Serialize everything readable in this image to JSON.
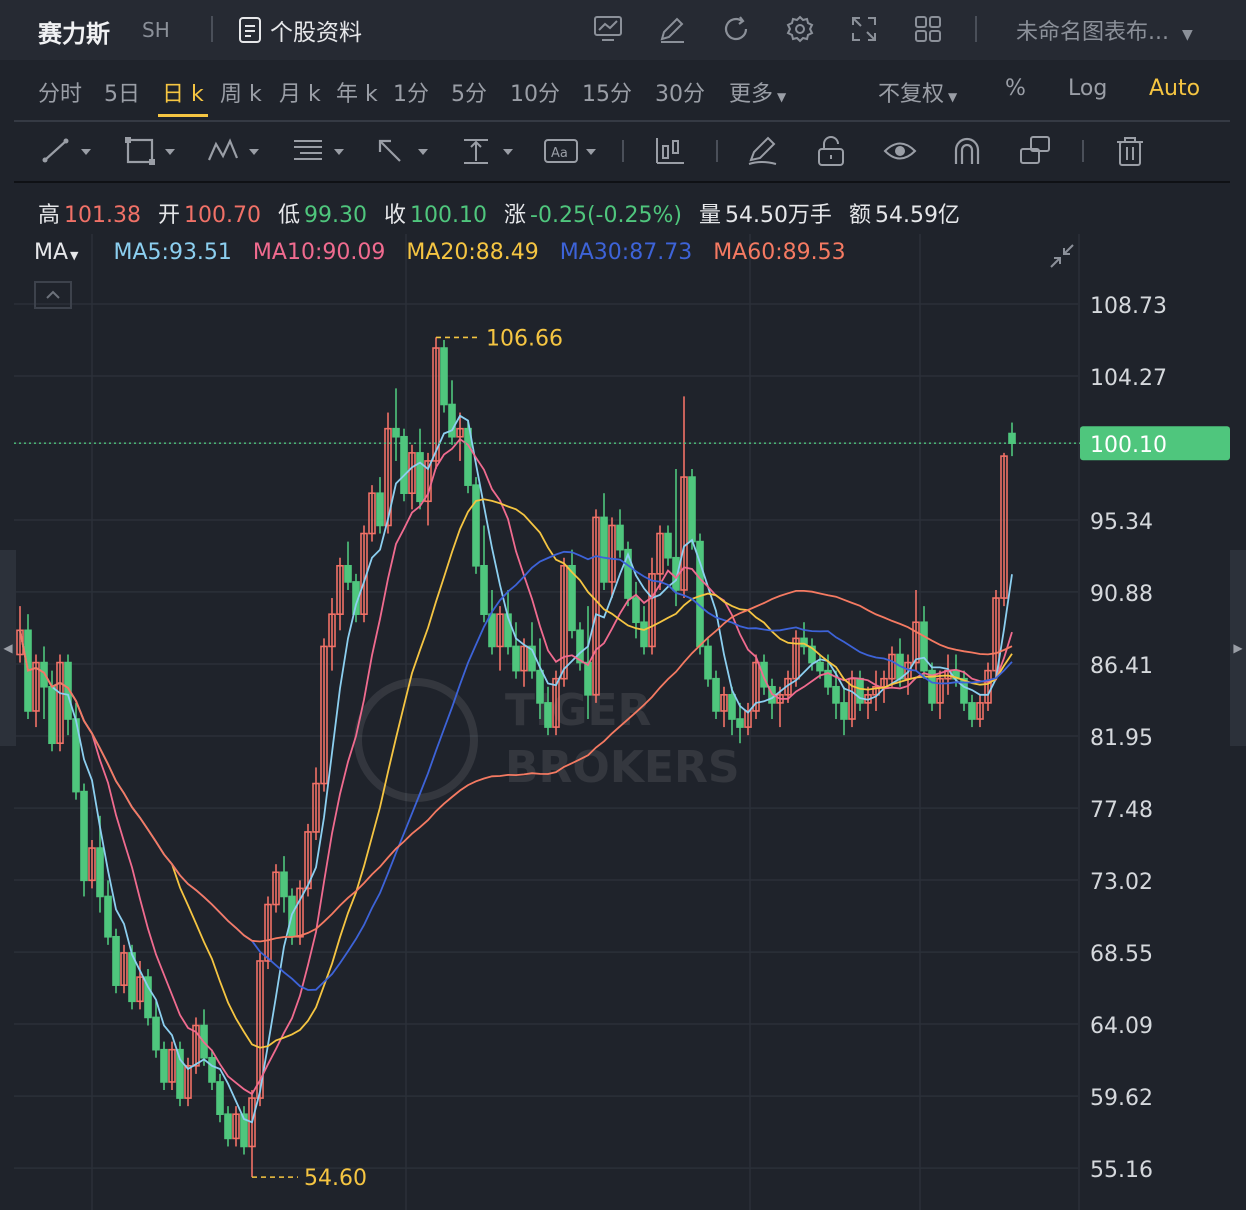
{
  "header": {
    "stock_name": "赛力斯",
    "market": "SH",
    "profile_label": "个股资料",
    "chart_selector": "未命名图表布...",
    "icons": [
      "chart-line-icon",
      "edit-icon",
      "refresh-icon",
      "gear-icon",
      "fullscreen-icon",
      "grid-icon"
    ]
  },
  "periods": {
    "items": [
      "分时",
      "5日",
      "日 k",
      "周 k",
      "月 k",
      "年 k",
      "1分",
      "5分",
      "10分",
      "15分",
      "30分",
      "更多"
    ],
    "active": "日 k",
    "adjust_label": "不复权",
    "percent_label": "%",
    "log_label": "Log",
    "auto_label": "Auto"
  },
  "toolbar": {
    "icons": [
      "trend-line-icon",
      "rectangle-icon",
      "pattern-icon",
      "fib-icon",
      "arrow-icon",
      "price-range-icon",
      "text-icon",
      "indicator-icon",
      "brush-icon",
      "lock-icon",
      "eye-icon",
      "magnet-icon",
      "layers-icon",
      "trash-icon"
    ]
  },
  "quote": {
    "high_label": "高",
    "high": "101.38",
    "open_label": "开",
    "open": "100.70",
    "low_label": "低",
    "low": "99.30",
    "close_label": "收",
    "close": "100.10",
    "change_label": "涨",
    "change": "-0.25(-0.25%)",
    "volume_label": "量",
    "volume": "54.50万手",
    "amount_label": "额",
    "amount": "54.59亿"
  },
  "ma": {
    "label": "MA",
    "ma5": "MA5:93.51",
    "ma10": "MA10:90.09",
    "ma20": "MA20:88.49",
    "ma30": "MA30:87.73",
    "ma60": "MA60:89.53"
  },
  "colors": {
    "up": "#f07167",
    "down": "#4fc67d",
    "ma5": "#8ccff0",
    "ma10": "#f06b8f",
    "ma20": "#f5c542",
    "ma30": "#3d63d8",
    "ma60": "#f57a62"
  },
  "watermark": "TIGER BROKERS",
  "chart_data": {
    "type": "candlestick",
    "y_ticks": [
      "108.73",
      "104.27",
      "100.10",
      "95.34",
      "90.88",
      "86.41",
      "81.95",
      "77.48",
      "73.02",
      "68.55",
      "64.09",
      "59.62",
      "55.16"
    ],
    "last_price": "100.10",
    "high_marker": "106.66",
    "low_marker": "54.60",
    "ylim": [
      53.5,
      110.5
    ],
    "candles": [
      [
        87,
        90,
        86.5,
        88.5
      ],
      [
        88.5,
        89.5,
        83,
        83.5
      ],
      [
        83.5,
        87,
        82.5,
        86.5
      ],
      [
        86.5,
        87.5,
        83,
        85
      ],
      [
        85,
        86,
        81,
        81.5
      ],
      [
        81.5,
        87,
        81,
        86.5
      ],
      [
        86.5,
        87,
        82,
        83
      ],
      [
        83,
        84,
        78,
        78.5
      ],
      [
        78.5,
        79,
        72,
        73
      ],
      [
        73,
        75.5,
        72.5,
        75
      ],
      [
        75,
        77,
        71,
        72
      ],
      [
        72,
        73,
        69,
        69.5
      ],
      [
        69.5,
        70,
        66,
        66.5
      ],
      [
        66.5,
        69,
        66,
        68.5
      ],
      [
        68.5,
        69,
        65,
        65.5
      ],
      [
        65.5,
        68,
        65,
        67
      ],
      [
        67,
        67.5,
        64,
        64.5
      ],
      [
        64.5,
        65.5,
        62,
        62.5
      ],
      [
        62.5,
        63,
        60,
        60.5
      ],
      [
        60.5,
        63,
        60,
        62.5
      ],
      [
        62.5,
        63,
        59,
        59.5
      ],
      [
        59.5,
        62,
        59,
        61.5
      ],
      [
        61.5,
        64.5,
        61,
        64
      ],
      [
        64,
        65,
        61.5,
        62
      ],
      [
        62,
        62.5,
        60,
        60.5
      ],
      [
        60.5,
        61,
        58,
        58.5
      ],
      [
        58.5,
        59,
        56.5,
        57
      ],
      [
        57,
        59,
        56.5,
        58.5
      ],
      [
        58.5,
        59,
        56,
        56.5
      ],
      [
        56.5,
        60,
        54.6,
        59.5
      ],
      [
        59.5,
        68.5,
        59,
        68
      ],
      [
        68,
        72,
        67.5,
        71.5
      ],
      [
        71.5,
        74,
        71,
        73.5
      ],
      [
        73.5,
        74.5,
        71,
        72
      ],
      [
        72,
        72.5,
        69,
        69.5
      ],
      [
        69.5,
        73,
        69,
        72.5
      ],
      [
        72.5,
        76.5,
        72,
        76
      ],
      [
        76,
        80,
        75.5,
        79
      ],
      [
        79,
        88,
        78.5,
        87.5
      ],
      [
        87.5,
        90.5,
        86,
        89.5
      ],
      [
        89.5,
        93,
        88.5,
        92.5
      ],
      [
        92.5,
        94,
        91,
        91.5
      ],
      [
        91.5,
        92,
        89,
        89.5
      ],
      [
        89.5,
        95,
        89,
        94.5
      ],
      [
        94.5,
        97.5,
        94,
        97
      ],
      [
        97,
        98,
        94.5,
        95
      ],
      [
        95,
        102,
        94.5,
        101
      ],
      [
        101,
        103.5,
        99,
        100.5
      ],
      [
        100.5,
        101,
        96.5,
        97
      ],
      [
        97,
        100,
        96,
        99.5
      ],
      [
        99.5,
        101,
        96,
        96.5
      ],
      [
        96.5,
        99.5,
        95,
        99
      ],
      [
        99,
        106.66,
        98.5,
        106
      ],
      [
        106,
        106.5,
        102,
        102.5
      ],
      [
        102.5,
        104,
        100,
        100.5
      ],
      [
        100.5,
        102,
        99,
        101
      ],
      [
        101,
        101.5,
        97,
        97.5
      ],
      [
        97.5,
        98,
        92,
        92.5
      ],
      [
        92.5,
        95,
        89,
        89.5
      ],
      [
        89.5,
        91,
        87,
        87.5
      ],
      [
        87.5,
        90,
        86,
        89.5
      ],
      [
        89.5,
        91,
        87,
        87.5
      ],
      [
        87.5,
        89,
        85.5,
        86
      ],
      [
        86,
        88,
        85,
        87.5
      ],
      [
        87.5,
        89,
        85.5,
        86
      ],
      [
        86,
        88,
        83,
        84
      ],
      [
        84,
        85,
        82,
        82.5
      ],
      [
        82.5,
        86,
        82,
        85.5
      ],
      [
        85.5,
        93,
        85,
        92.5
      ],
      [
        92.5,
        93.5,
        88,
        88.5
      ],
      [
        88.5,
        89,
        86,
        86.5
      ],
      [
        86.5,
        90,
        83,
        84.5
      ],
      [
        84.5,
        96,
        84,
        95.5
      ],
      [
        95.5,
        97,
        91,
        91.5
      ],
      [
        91.5,
        95.5,
        90.5,
        95
      ],
      [
        95,
        96,
        93,
        93.5
      ],
      [
        93.5,
        94,
        90,
        90.5
      ],
      [
        90.5,
        91.5,
        88,
        89
      ],
      [
        89,
        90,
        87,
        87.5
      ],
      [
        87.5,
        93,
        87,
        92
      ],
      [
        92,
        95,
        91,
        94.5
      ],
      [
        94.5,
        95,
        92.5,
        93
      ],
      [
        93,
        98.5,
        90,
        91
      ],
      [
        91,
        103,
        90.5,
        98
      ],
      [
        98,
        98.5,
        93.5,
        94
      ],
      [
        94,
        94.5,
        87,
        87.5
      ],
      [
        87.5,
        88,
        85,
        85.5
      ],
      [
        85.5,
        86,
        83,
        83.5
      ],
      [
        83.5,
        85,
        82.5,
        84.5
      ],
      [
        84.5,
        85,
        82,
        83
      ],
      [
        83,
        84,
        81.5,
        82.5
      ],
      [
        82.5,
        84,
        82,
        83.5
      ],
      [
        83.5,
        87,
        83,
        86.5
      ],
      [
        86.5,
        87,
        84.5,
        85
      ],
      [
        85,
        85.5,
        83,
        84
      ],
      [
        84,
        85,
        82.5,
        84.5
      ],
      [
        84.5,
        86,
        84,
        85.5
      ],
      [
        85.5,
        88.5,
        85,
        88
      ],
      [
        88,
        89,
        87,
        87.5
      ],
      [
        87.5,
        88,
        86,
        86.5
      ],
      [
        86.5,
        87,
        85.5,
        86
      ],
      [
        86,
        87,
        84.5,
        85
      ],
      [
        85,
        86,
        83,
        84
      ],
      [
        84,
        85,
        82,
        83
      ],
      [
        83,
        86,
        82.5,
        85.5
      ],
      [
        85.5,
        86,
        83.5,
        84
      ],
      [
        84,
        85,
        83,
        84.5
      ],
      [
        84.5,
        86,
        83.5,
        85
      ],
      [
        85,
        86,
        84,
        85.5
      ],
      [
        85.5,
        87.5,
        85,
        87
      ],
      [
        87,
        88,
        85,
        85.5
      ],
      [
        85.5,
        87,
        84.5,
        86.5
      ],
      [
        86.5,
        91,
        86,
        89
      ],
      [
        89,
        90,
        85.5,
        86
      ],
      [
        86,
        86.5,
        83.5,
        84
      ],
      [
        84,
        86,
        83,
        85.5
      ],
      [
        85.5,
        87,
        84.5,
        86
      ],
      [
        86,
        87,
        85,
        85.5
      ],
      [
        85.5,
        86,
        83.5,
        84
      ],
      [
        84,
        84.5,
        82.5,
        83
      ],
      [
        83,
        84.5,
        82.5,
        84
      ],
      [
        84,
        86.5,
        83.5,
        86
      ],
      [
        86,
        91,
        85.5,
        90.5
      ],
      [
        90.5,
        99.5,
        90,
        99.3
      ],
      [
        100.7,
        101.38,
        99.3,
        100.1
      ]
    ]
  }
}
